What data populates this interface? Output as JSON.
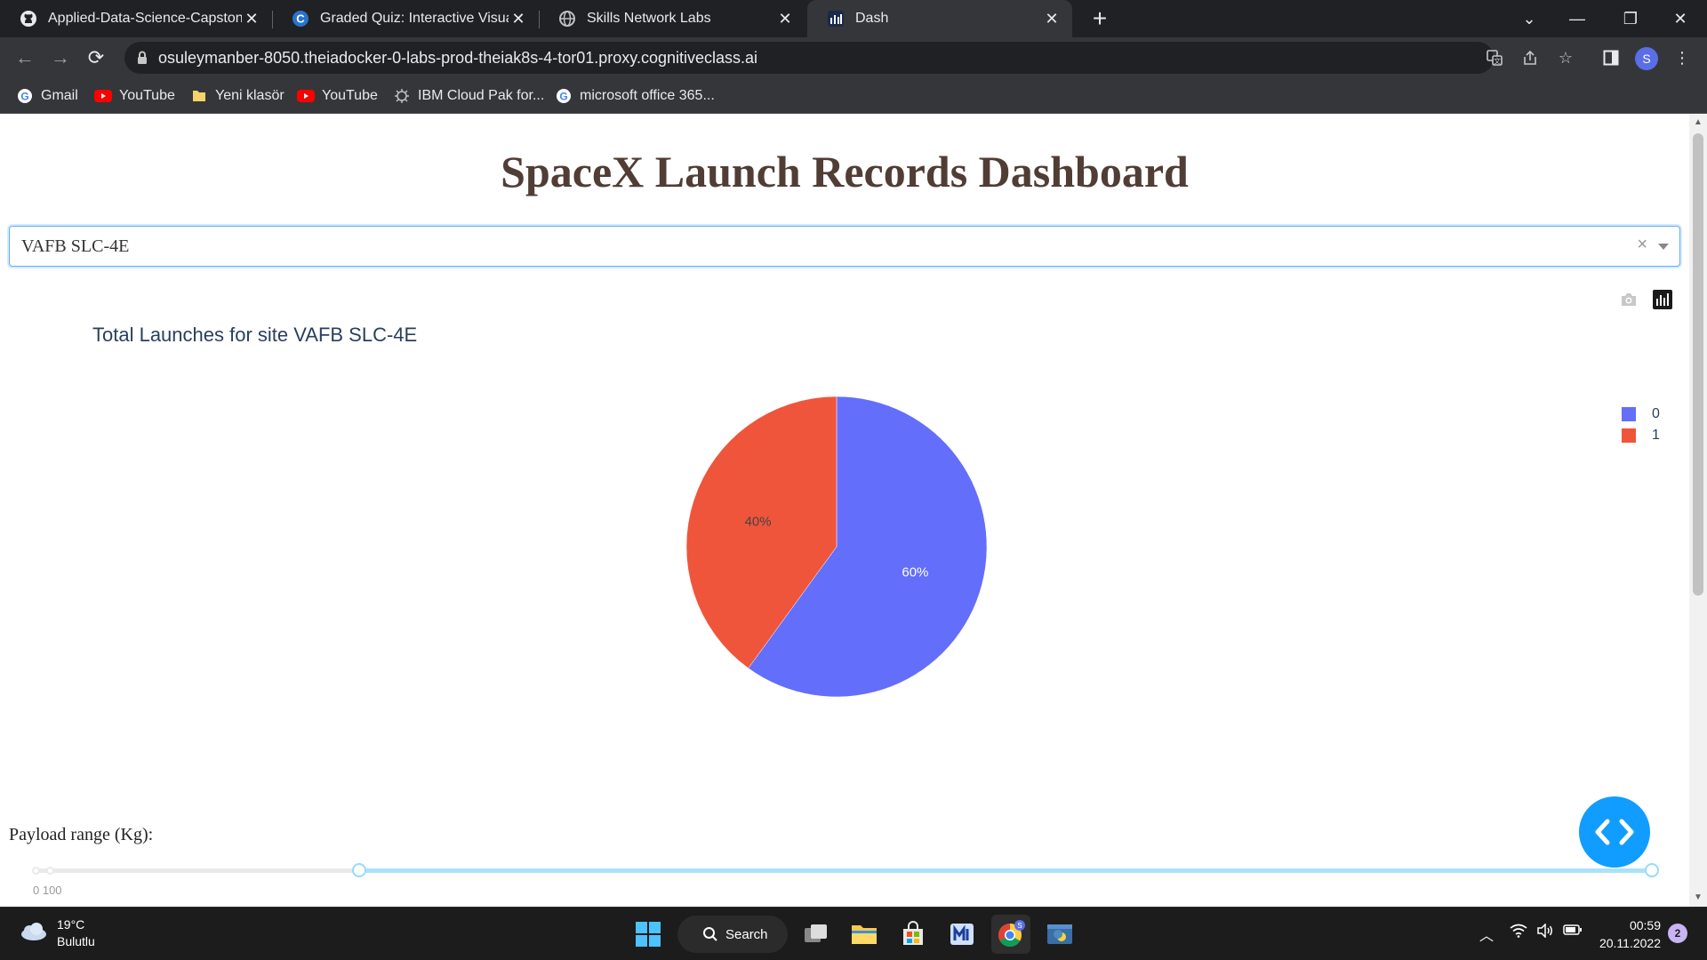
{
  "browser": {
    "tabs": [
      {
        "title": "Applied-Data-Science-Capstone-",
        "icon": "github-icon"
      },
      {
        "title": "Graded Quiz: Interactive Visual A",
        "icon": "coursera-icon"
      },
      {
        "title": "Skills Network Labs",
        "icon": "globe-icon"
      },
      {
        "title": "Dash",
        "icon": "dash-icon",
        "active": true
      }
    ],
    "url": "osuleymanber-8050.theiadocker-0-labs-prod-theiak8s-4-tor01.proxy.cognitiveclass.ai",
    "profile_initial": "S",
    "bookmarks": [
      {
        "label": "Gmail",
        "icon": "google-icon"
      },
      {
        "label": "YouTube",
        "icon": "youtube-icon"
      },
      {
        "label": "Yeni klasör",
        "icon": "folder-icon"
      },
      {
        "label": "YouTube",
        "icon": "youtube-icon"
      },
      {
        "label": "IBM Cloud Pak for...",
        "icon": "ibm-icon"
      },
      {
        "label": "microsoft office 365...",
        "icon": "google-icon"
      }
    ]
  },
  "dashboard": {
    "title": "SpaceX Launch Records Dashboard",
    "site_dropdown": {
      "selected": "VAFB SLC-4E",
      "clear_symbol": "×"
    },
    "chart_title": "Total Launches for site VAFB SLC-4E",
    "payload_label": "Payload range (Kg):",
    "slider_marks": "0 100"
  },
  "chart_data": {
    "type": "pie",
    "title": "Total Launches for site VAFB SLC-4E",
    "categories": [
      "0",
      "1"
    ],
    "values": [
      60,
      40
    ],
    "labels": [
      "60%",
      "40%"
    ],
    "colors": [
      "#636efa",
      "#ef553b"
    ],
    "legend": "top-right"
  },
  "taskbar": {
    "weather_temp": "19°C",
    "weather_desc": "Bulutlu",
    "search_label": "Search",
    "time": "00:59",
    "date": "20.11.2022",
    "notification_count": "2"
  }
}
